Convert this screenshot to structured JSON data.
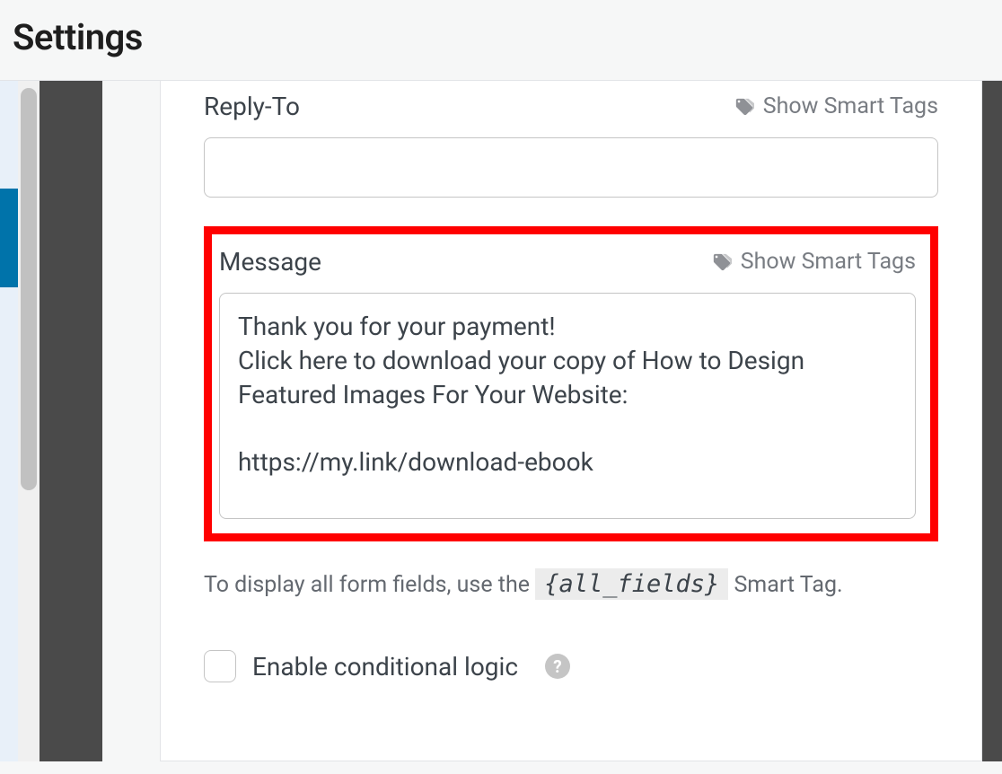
{
  "header": {
    "title": "Settings"
  },
  "fields": {
    "reply_to": {
      "label": "Reply-To",
      "smart_tags_label": "Show Smart Tags",
      "value": ""
    },
    "message": {
      "label": "Message",
      "smart_tags_label": "Show Smart Tags",
      "value": "Thank you for your payment!\nClick here to download your copy of How to Design Featured Images For Your Website:\n\nhttps://my.link/download-ebook"
    }
  },
  "hint": {
    "prefix": "To display all form fields, use the ",
    "tag": "{all_fields}",
    "suffix": " Smart Tag."
  },
  "conditional": {
    "label": "Enable conditional logic",
    "checked": false
  }
}
